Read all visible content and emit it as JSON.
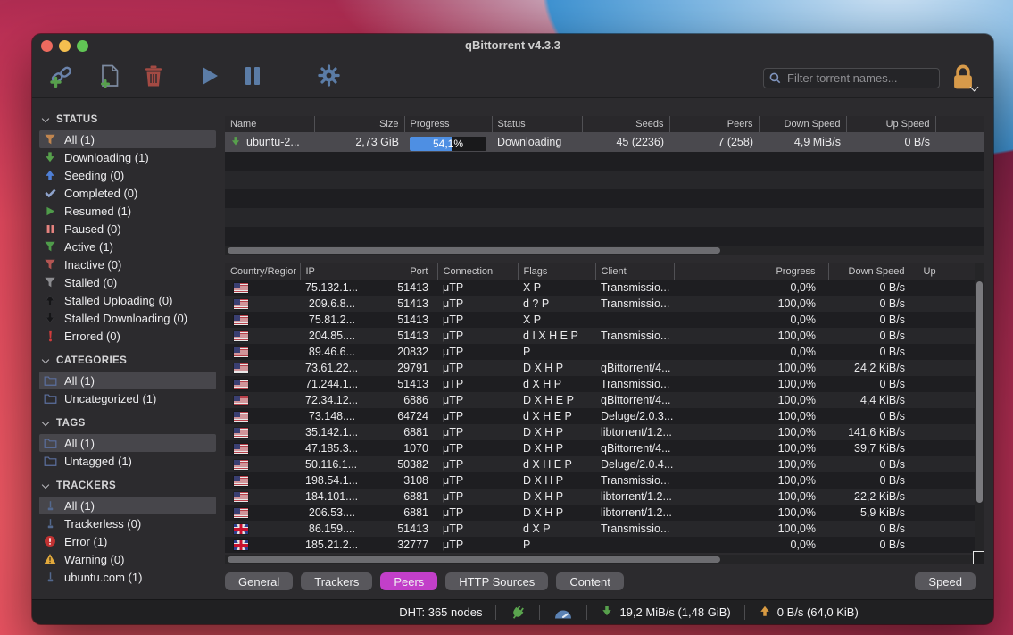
{
  "window": {
    "title": "qBittorrent v4.3.3"
  },
  "toolbar": {
    "filter_placeholder": "Filter torrent names..."
  },
  "colors": {
    "progress_fill": "#4e8fe3",
    "tab_active": "#c23fc9",
    "lock_orange": "#d79a4a",
    "selected_row": "#4a494e"
  },
  "sidebar": {
    "status": {
      "title": "STATUS",
      "items": [
        {
          "label": "All (1)"
        },
        {
          "label": "Downloading (1)"
        },
        {
          "label": "Seeding (0)"
        },
        {
          "label": "Completed (0)"
        },
        {
          "label": "Resumed (1)"
        },
        {
          "label": "Paused (0)"
        },
        {
          "label": "Active (1)"
        },
        {
          "label": "Inactive (0)"
        },
        {
          "label": "Stalled (0)"
        },
        {
          "label": "Stalled Uploading (0)"
        },
        {
          "label": "Stalled Downloading (0)"
        },
        {
          "label": "Errored (0)"
        }
      ]
    },
    "categories": {
      "title": "CATEGORIES",
      "items": [
        {
          "label": "All (1)"
        },
        {
          "label": "Uncategorized (1)"
        }
      ]
    },
    "tags": {
      "title": "TAGS",
      "items": [
        {
          "label": "All (1)"
        },
        {
          "label": "Untagged (1)"
        }
      ]
    },
    "trackers": {
      "title": "TRACKERS",
      "items": [
        {
          "label": "All (1)"
        },
        {
          "label": "Trackerless (0)"
        },
        {
          "label": "Error (1)"
        },
        {
          "label": "Warning (0)"
        },
        {
          "label": "ubuntu.com (1)"
        }
      ]
    }
  },
  "torrents": {
    "columns": {
      "name": "Name",
      "size": "Size",
      "progress": "Progress",
      "status": "Status",
      "seeds": "Seeds",
      "peers": "Peers",
      "down": "Down Speed",
      "up": "Up Speed"
    },
    "row": {
      "name": "ubuntu-2...",
      "size": "2,73 GiB",
      "progress_label": "54,1%",
      "progress_pct": "54.1",
      "status": "Downloading",
      "seeds": "45 (2236)",
      "peers": "7 (258)",
      "down": "4,9 MiB/s",
      "up": "0 B/s"
    }
  },
  "peers": {
    "columns": {
      "country": "Country/Regior",
      "ip": "IP",
      "port": "Port",
      "connection": "Connection",
      "flags": "Flags",
      "client": "Client",
      "progress": "Progress",
      "down": "Down Speed",
      "up": "Up"
    },
    "rows": [
      {
        "country": "US",
        "ip": "75.132.1...",
        "port": "51413",
        "conn": "μTP",
        "flags": "X P",
        "client": "Transmissio...",
        "progress": "0,0%",
        "down": "0 B/s",
        "up": ""
      },
      {
        "country": "US",
        "ip": "209.6.8...",
        "port": "51413",
        "conn": "μTP",
        "flags": "d ? P",
        "client": "Transmissio...",
        "progress": "100,0%",
        "down": "0 B/s",
        "up": ""
      },
      {
        "country": "US",
        "ip": "75.81.2...",
        "port": "51413",
        "conn": "μTP",
        "flags": "X P",
        "client": "",
        "progress": "0,0%",
        "down": "0 B/s",
        "up": ""
      },
      {
        "country": "US",
        "ip": "204.85....",
        "port": "51413",
        "conn": "μTP",
        "flags": "d I X H E P",
        "client": "Transmissio...",
        "progress": "100,0%",
        "down": "0 B/s",
        "up": ""
      },
      {
        "country": "US",
        "ip": "89.46.6...",
        "port": "20832",
        "conn": "μTP",
        "flags": "P",
        "client": "",
        "progress": "0,0%",
        "down": "0 B/s",
        "up": ""
      },
      {
        "country": "US",
        "ip": "73.61.22...",
        "port": "29791",
        "conn": "μTP",
        "flags": "D X H P",
        "client": "qBittorrent/4...",
        "progress": "100,0%",
        "down": "24,2 KiB/s",
        "up": ""
      },
      {
        "country": "US",
        "ip": "71.244.1...",
        "port": "51413",
        "conn": "μTP",
        "flags": "d X H P",
        "client": "Transmissio...",
        "progress": "100,0%",
        "down": "0 B/s",
        "up": ""
      },
      {
        "country": "US",
        "ip": "72.34.12...",
        "port": "6886",
        "conn": "μTP",
        "flags": "D X H E P",
        "client": "qBittorrent/4...",
        "progress": "100,0%",
        "down": "4,4 KiB/s",
        "up": ""
      },
      {
        "country": "US",
        "ip": "73.148....",
        "port": "64724",
        "conn": "μTP",
        "flags": "d X H E P",
        "client": "Deluge/2.0.3...",
        "progress": "100,0%",
        "down": "0 B/s",
        "up": ""
      },
      {
        "country": "US",
        "ip": "35.142.1...",
        "port": "6881",
        "conn": "μTP",
        "flags": "D X H P",
        "client": "libtorrent/1.2...",
        "progress": "100,0%",
        "down": "141,6 KiB/s",
        "up": ""
      },
      {
        "country": "US",
        "ip": "47.185.3...",
        "port": "1070",
        "conn": "μTP",
        "flags": "D X H P",
        "client": "qBittorrent/4...",
        "progress": "100,0%",
        "down": "39,7 KiB/s",
        "up": ""
      },
      {
        "country": "US",
        "ip": "50.116.1...",
        "port": "50382",
        "conn": "μTP",
        "flags": "d X H E P",
        "client": "Deluge/2.0.4...",
        "progress": "100,0%",
        "down": "0 B/s",
        "up": ""
      },
      {
        "country": "US",
        "ip": "198.54.1...",
        "port": "3108",
        "conn": "μTP",
        "flags": "D X H P",
        "client": "Transmissio...",
        "progress": "100,0%",
        "down": "0 B/s",
        "up": ""
      },
      {
        "country": "US",
        "ip": "184.101....",
        "port": "6881",
        "conn": "μTP",
        "flags": "D X H P",
        "client": "libtorrent/1.2...",
        "progress": "100,0%",
        "down": "22,2 KiB/s",
        "up": ""
      },
      {
        "country": "US",
        "ip": "206.53....",
        "port": "6881",
        "conn": "μTP",
        "flags": "D X H P",
        "client": "libtorrent/1.2...",
        "progress": "100,0%",
        "down": "5,9 KiB/s",
        "up": ""
      },
      {
        "country": "GB",
        "ip": "86.159....",
        "port": "51413",
        "conn": "μTP",
        "flags": "d X P",
        "client": "Transmissio...",
        "progress": "100,0%",
        "down": "0 B/s",
        "up": ""
      },
      {
        "country": "GB",
        "ip": "185.21.2...",
        "port": "32777",
        "conn": "μTP",
        "flags": "P",
        "client": "",
        "progress": "0,0%",
        "down": "0 B/s",
        "up": ""
      }
    ]
  },
  "tabs": {
    "items": [
      "General",
      "Trackers",
      "Peers",
      "HTTP Sources",
      "Content"
    ],
    "active": "Peers",
    "right": "Speed"
  },
  "statusbar": {
    "dht": "DHT: 365 nodes",
    "down": "19,2 MiB/s (1,48 GiB)",
    "up": "0 B/s (64,0 KiB)"
  }
}
